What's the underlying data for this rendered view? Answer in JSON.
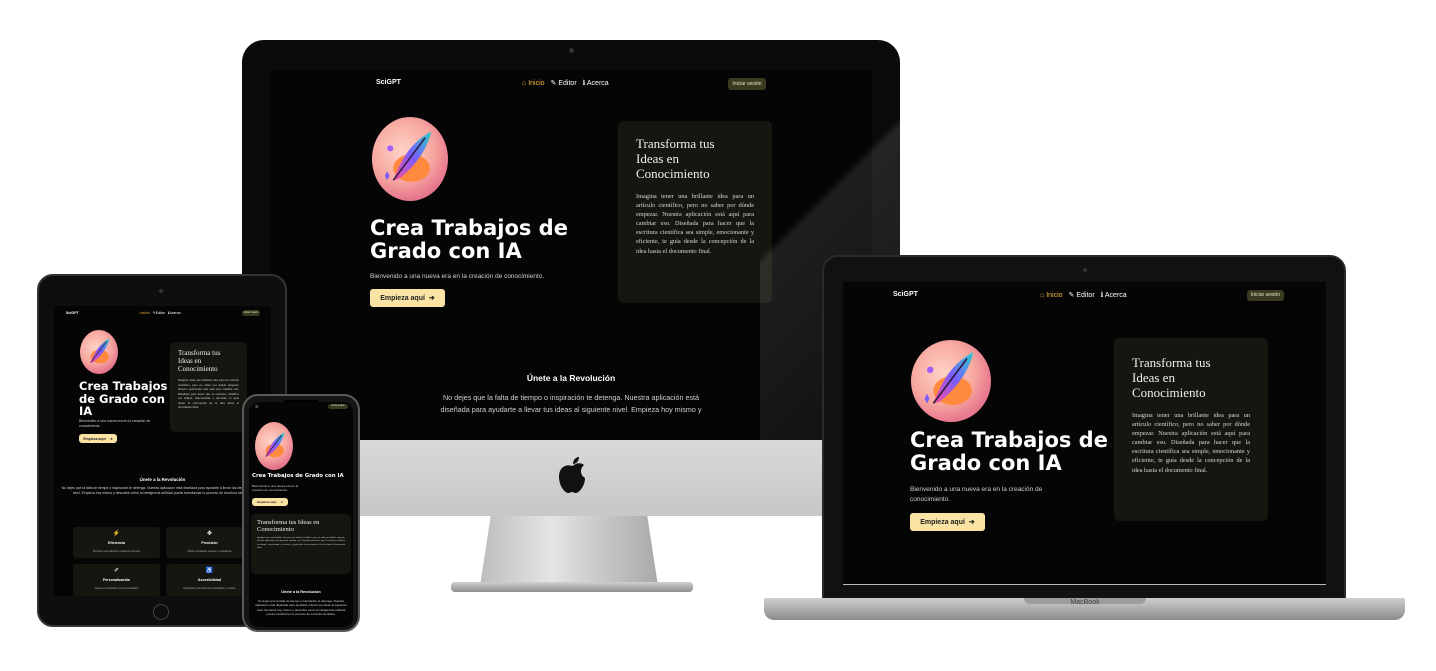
{
  "site": {
    "brand": "SciGPT",
    "nav": [
      {
        "icon": "home-icon",
        "glyph": "⌂",
        "label": "Inicio",
        "active": true
      },
      {
        "icon": "feather-icon",
        "glyph": "✎",
        "label": "Editor",
        "active": false
      },
      {
        "icon": "info-icon",
        "glyph": "ℹ",
        "label": "Acerca",
        "active": false
      }
    ],
    "login": "Iniciar sesión",
    "hero_title": "Crea Trabajos de Grado con IA",
    "hero_title_line1": "Crea Trabajos de",
    "hero_title_line2": "Grado con IA",
    "hero_subtitle": "Bienvenido a una nueva era en la creación de conocimiento.",
    "hero_subtitle_line1": "Bienvenido a una nueva era en la creación de",
    "hero_subtitle_line2": "conocimiento.",
    "cta": "Empieza aquí",
    "cta_arrow": "➔",
    "card_title": "Transforma tus Ideas en Conocimiento",
    "card_title_l1": "Transforma tus",
    "card_title_l2": "Ideas en",
    "card_title_l3": "Conocimiento",
    "card_body": "Imagina tener una brillante idea para un artículo científico, pero no saber por dónde empezar. Nuestra aplicación está aquí para cambiar eso. Diseñada para hacer que la escritura científica sea simple, emocionante y eficiente, te guía desde la concepción de la idea hasta el documento final.",
    "section_title": "Únete a la Revolución",
    "section_text_line1": "No dejes que la falta de tiempo o inspiración te detenga. Nuestra aplicación está",
    "section_text_line2": "diseñada para ayudarte a llevar tus ideas al siguiente nivel. Empieza hoy mismo y",
    "section_text_full": "No dejes que la falta de tiempo o inspiración te detenga. Nuestra aplicación está diseñada para ayudarte a llevar tus ideas al siguiente nivel. Empieza hoy mismo y descubre cómo la inteligencia artificial puede transformar tu proceso de escritura científica.",
    "features": [
      {
        "icon": "lightning-icon",
        "glyph": "⚡",
        "title": "Eficiencia",
        "text": "Permite una redacción rápida en minutos"
      },
      {
        "icon": "target-icon",
        "glyph": "✥",
        "title": "Precisión",
        "text": "Obtén resultados exactos y relevantes"
      },
      {
        "icon": "brush-icon",
        "glyph": "✐",
        "title": "Personalización",
        "text": "Ajusta el contenido a tus necesidades"
      },
      {
        "icon": "accessibility-icon",
        "glyph": "♿",
        "title": "Accesibilidad",
        "text": "Disponible para diversas disciplinas y niveles"
      }
    ]
  },
  "devices": {
    "laptop_brand": "MacBook"
  },
  "colors": {
    "background": "#050505",
    "accent": "#f6b93b",
    "cta_bg": "#fbe3a3",
    "card_bg": "#16150f"
  }
}
